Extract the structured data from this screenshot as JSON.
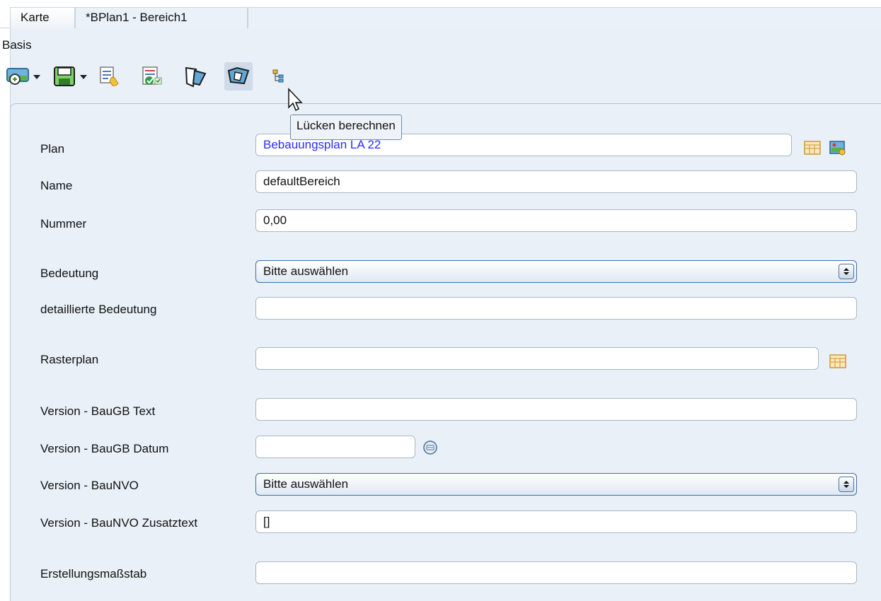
{
  "tabs": [
    {
      "label": "Karte"
    },
    {
      "label": "*BPlan1 - Bereich1"
    }
  ],
  "section_title": "Basis",
  "toolbar": {
    "tooltip": "Lücken berechnen",
    "icons": [
      "map-zoom-icon",
      "save-icon",
      "edit-attributes-icon",
      "validate-icon",
      "geometry-icon",
      "compute-gaps-icon",
      "tree-structure-icon"
    ]
  },
  "form": {
    "plan": {
      "label": "Plan",
      "value": "Bebauungsplan LA 22"
    },
    "name": {
      "label": "Name",
      "value": "defaultBereich"
    },
    "nummer": {
      "label": "Nummer",
      "value": "0,00"
    },
    "bedeutung": {
      "label": "Bedeutung",
      "value": "Bitte auswählen"
    },
    "detaillierte_bedeutung": {
      "label": "detaillierte Bedeutung",
      "value": ""
    },
    "rasterplan": {
      "label": "Rasterplan",
      "value": ""
    },
    "version_baugb_text": {
      "label": "Version - BauGB Text",
      "value": ""
    },
    "version_baugb_datum": {
      "label": "Version - BauGB Datum",
      "value": ""
    },
    "version_baunvo": {
      "label": "Version - BauNVO",
      "value": "Bitte auswählen"
    },
    "version_baunvo_zusatztext": {
      "label": "Version - BauNVO Zusatztext",
      "value": "[]"
    },
    "erstellungsmassstab": {
      "label": "Erstellungsmaßstab",
      "value": ""
    }
  },
  "colors": {
    "panel_bg": "#e9f0f7",
    "field_border": "#a9b7c6",
    "link_text": "#2b2bff",
    "select_border": "#3d6fa8"
  }
}
